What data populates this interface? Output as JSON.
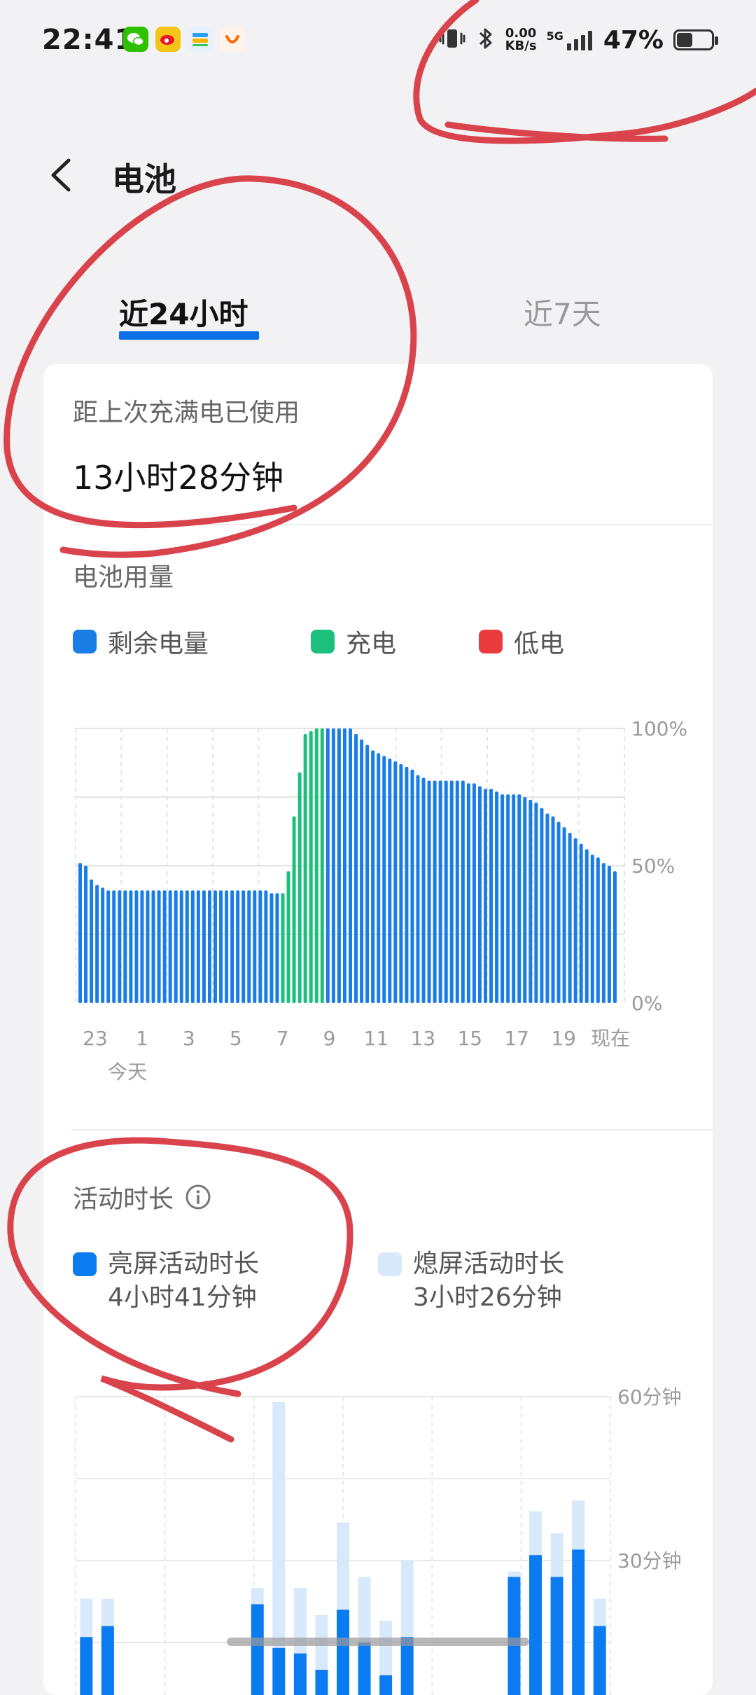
{
  "status_bar": {
    "time": "22:41",
    "net_speed_value": "0.00",
    "net_speed_unit": "KB/s",
    "network": "5G",
    "battery_percent": "47%",
    "battery_level": 0.47
  },
  "header": {
    "title": "电池"
  },
  "tabs": [
    {
      "label": "近24小时",
      "active": true
    },
    {
      "label": "近7天",
      "active": false
    }
  ],
  "since_full": {
    "label": "距上次充满电已使用",
    "value": "13小时28分钟"
  },
  "battery_usage": {
    "title": "电池用量",
    "legend": [
      {
        "label": "剩余电量",
        "color": "#1a7de6"
      },
      {
        "label": "充电",
        "color": "#1dbf7d"
      },
      {
        "label": "低电",
        "color": "#ea3c3c"
      }
    ]
  },
  "activity": {
    "title": "活动时长",
    "screen_on": {
      "label": "亮屏活动时长",
      "value": "4小时41分钟",
      "color": "#0a7bf0"
    },
    "screen_off": {
      "label": "熄屏活动时长",
      "value": "3小时26分钟",
      "color": "#d8e9fb"
    }
  },
  "chart_data": [
    {
      "type": "bar",
      "title": "电池用量",
      "y_tick_labels": [
        "100%",
        "50%",
        "0%"
      ],
      "x_tick_labels": [
        "23",
        "1",
        "3",
        "5",
        "7",
        "9",
        "11",
        "13",
        "15",
        "17",
        "19",
        "现在"
      ],
      "x_sub_label": "今天",
      "ylim": [
        0,
        100
      ],
      "series": [
        {
          "name": "剩余电量",
          "color": "#1a7de6",
          "values": [
            51,
            50,
            45,
            43,
            42,
            41,
            41,
            41,
            41,
            41,
            41,
            41,
            41,
            41,
            41,
            41,
            41,
            41,
            41,
            41,
            41,
            41,
            41,
            41,
            41,
            41,
            41,
            41,
            41,
            41,
            41,
            41,
            41,
            41,
            40,
            40,
            40,
            48,
            68,
            84,
            98,
            99,
            100,
            100,
            100,
            100,
            100,
            100,
            100,
            98,
            96,
            94,
            92,
            91,
            90,
            89,
            88,
            87,
            86,
            85,
            83,
            82,
            81,
            81,
            81,
            81,
            81,
            81,
            81,
            80,
            80,
            79,
            78,
            78,
            77,
            76,
            76,
            76,
            76,
            75,
            74,
            73,
            71,
            69,
            68,
            66,
            64,
            62,
            60,
            58,
            56,
            54,
            53,
            51,
            50,
            48
          ],
          "charging_index_range": [
            36,
            43
          ]
        }
      ]
    },
    {
      "type": "bar",
      "title": "活动时长",
      "y_tick_labels": [
        "60分钟",
        "30分钟",
        "0分钟"
      ],
      "ylim": [
        0,
        60
      ],
      "series": [
        {
          "name": "亮屏活动时长",
          "color": "#0a7bf0",
          "values": [
            16,
            18,
            2,
            2,
            2,
            0,
            0,
            0,
            22,
            14,
            13,
            10,
            21,
            15,
            9,
            16,
            3,
            2,
            2,
            3,
            27,
            31,
            27,
            32,
            18
          ]
        },
        {
          "name": "熄屏活动时长",
          "color": "#d8e9fb",
          "values": [
            7,
            5,
            0,
            0,
            0,
            0,
            0,
            0,
            3,
            45,
            12,
            10,
            16,
            12,
            10,
            14,
            1,
            0,
            0,
            0,
            1,
            8,
            8,
            9,
            5
          ]
        }
      ]
    }
  ]
}
